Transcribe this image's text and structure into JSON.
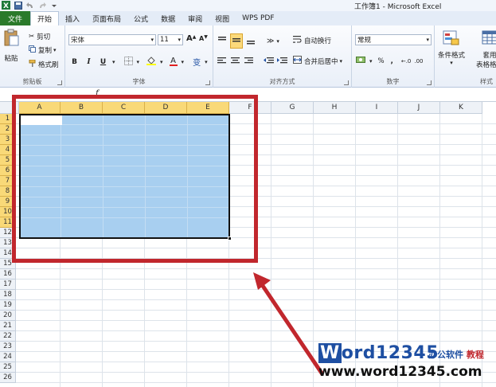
{
  "window": {
    "title": "工作簿1 - Microsoft Excel"
  },
  "tabs": [
    "文件",
    "开始",
    "插入",
    "页面布局",
    "公式",
    "数据",
    "审阅",
    "视图",
    "WPS PDF"
  ],
  "clipboard": {
    "paste": "粘贴",
    "cut": "剪切",
    "copy": "复制",
    "format_painter": "格式刷",
    "label": "剪贴板"
  },
  "font": {
    "name": "宋体",
    "size": "11",
    "grow": "A",
    "shrink": "A",
    "bold": "B",
    "italic": "I",
    "underline": "U",
    "font_color": "A",
    "phonetic": "变",
    "label": "字体"
  },
  "alignment": {
    "wrap": "自动换行",
    "merge": "合并后居中",
    "label": "对齐方式"
  },
  "number": {
    "format": "常规",
    "percent": "%",
    "comma": ",",
    "label": "数字"
  },
  "styles": {
    "conditional": "条件格式",
    "table_line1": "套用",
    "table_line2": "表格格式",
    "label": "样式"
  },
  "formula_bar": {
    "fx": "f"
  },
  "columns": [
    "A",
    "B",
    "C",
    "D",
    "E",
    "F",
    "G",
    "H",
    "I",
    "J",
    "K"
  ],
  "rows": [
    "1",
    "2",
    "3",
    "4",
    "5",
    "6",
    "7",
    "8",
    "9",
    "10",
    "11",
    "12",
    "13",
    "14",
    "15",
    "16",
    "17",
    "18",
    "19",
    "20",
    "21",
    "22",
    "23",
    "24",
    "25",
    "26"
  ],
  "watermark": {
    "w": "W",
    "ord": "ord",
    "num": "12345",
    "cn1": "办公软件",
    "cn2": "教程",
    "url": "www.word12345.com"
  }
}
